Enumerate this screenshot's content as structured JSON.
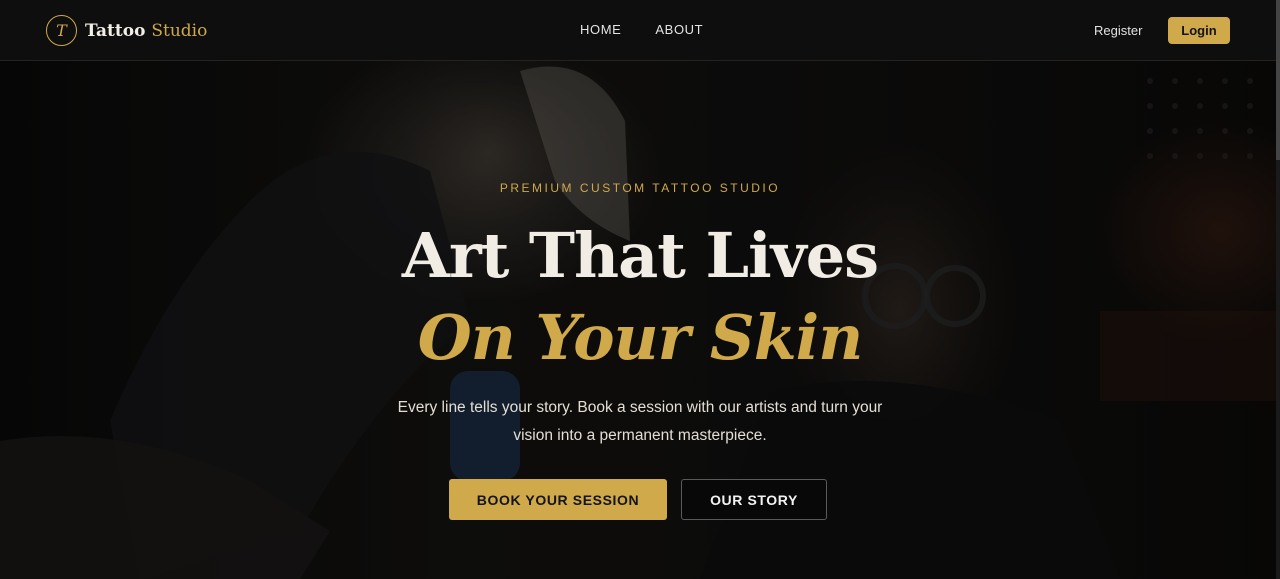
{
  "brand": {
    "mark": "T",
    "name_part1": "Tattoo",
    "name_part2": "Studio"
  },
  "nav": {
    "links": [
      {
        "label": "HOME"
      },
      {
        "label": "ABOUT"
      }
    ]
  },
  "auth": {
    "register_label": "Register",
    "login_label": "Login"
  },
  "hero": {
    "eyebrow": "PREMIUM CUSTOM TATTOO STUDIO",
    "title_line1": "Art That Lives",
    "title_line2": "On Your Skin",
    "subtitle": "Every line tells your story. Book a session with our artists and turn your vision into a permanent masterpiece.",
    "primary_cta": "BOOK YOUR SESSION",
    "secondary_cta": "OUR STORY"
  },
  "colors": {
    "accent": "#cfa94a",
    "background": "#0b0b0b",
    "text_light": "#f1ede4"
  }
}
